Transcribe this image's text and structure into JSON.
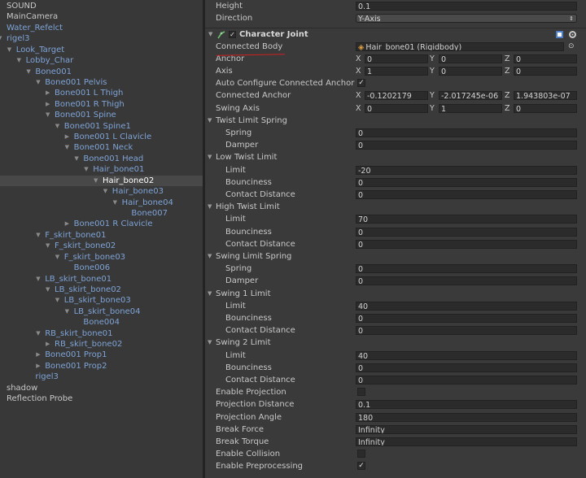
{
  "hierarchy": {
    "items": [
      {
        "label": "SOUND",
        "color": "plain",
        "expanded": null
      },
      {
        "label": "MainCamera",
        "color": "plain",
        "expanded": null
      },
      {
        "label": "Water_Refelct",
        "color": "blue",
        "expanded": null
      },
      {
        "label": "rigel3",
        "color": "blue",
        "expanded": true
      },
      {
        "label": "Look_Target",
        "color": "blue",
        "expanded": true
      },
      {
        "label": "Lobby_Char",
        "color": "blue",
        "expanded": true
      },
      {
        "label": "Bone001",
        "color": "blue",
        "expanded": true
      },
      {
        "label": "Bone001 Pelvis",
        "color": "blue",
        "expanded": true
      },
      {
        "label": "Bone001 L Thigh",
        "color": "blue",
        "expanded": false
      },
      {
        "label": "Bone001 R Thigh",
        "color": "blue",
        "expanded": false
      },
      {
        "label": "Bone001 Spine",
        "color": "blue",
        "expanded": true
      },
      {
        "label": "Bone001 Spine1",
        "color": "blue",
        "expanded": true
      },
      {
        "label": "Bone001 L Clavicle",
        "color": "blue",
        "expanded": false
      },
      {
        "label": "Bone001 Neck",
        "color": "blue",
        "expanded": true
      },
      {
        "label": "Bone001 Head",
        "color": "blue",
        "expanded": true
      },
      {
        "label": "Hair_bone01",
        "color": "blue",
        "expanded": true
      },
      {
        "label": "Hair_bone02",
        "color": "blue",
        "expanded": true,
        "selected": true
      },
      {
        "label": "Hair_bone03",
        "color": "blue",
        "expanded": true
      },
      {
        "label": "Hair_bone04",
        "color": "blue",
        "expanded": true
      },
      {
        "label": "Bone007",
        "color": "blue",
        "expanded": null
      },
      {
        "label": "Bone001 R Clavicle",
        "color": "blue",
        "expanded": false
      },
      {
        "label": "F_skirt_bone01",
        "color": "blue",
        "expanded": true
      },
      {
        "label": "F_skirt_bone02",
        "color": "blue",
        "expanded": true
      },
      {
        "label": "F_skirt_bone03",
        "color": "blue",
        "expanded": true
      },
      {
        "label": "Bone006",
        "color": "blue",
        "expanded": null
      },
      {
        "label": "LB_skirt_bone01",
        "color": "blue",
        "expanded": true
      },
      {
        "label": "LB_skirt_bone02",
        "color": "blue",
        "expanded": true
      },
      {
        "label": "LB_skirt_bone03",
        "color": "blue",
        "expanded": true
      },
      {
        "label": "LB_skirt_bone04",
        "color": "blue",
        "expanded": true
      },
      {
        "label": "Bone004",
        "color": "blue",
        "expanded": null
      },
      {
        "label": "RB_skirt_bone01",
        "color": "blue",
        "expanded": true
      },
      {
        "label": "RB_skirt_bone02",
        "color": "blue",
        "expanded": false
      },
      {
        "label": "Bone001 Prop1",
        "color": "blue",
        "expanded": false
      },
      {
        "label": "Bone001 Prop2",
        "color": "blue",
        "expanded": false
      },
      {
        "label": "rigel3",
        "color": "blue",
        "expanded": null
      },
      {
        "label": "shadow",
        "color": "plain",
        "expanded": null
      },
      {
        "label": "Reflection Probe",
        "color": "plain",
        "expanded": null
      }
    ]
  },
  "inspector": {
    "top_rows": [
      {
        "label": "Height",
        "value": "0.1"
      },
      {
        "label": "Direction",
        "value": "Y-Axis",
        "dropdown": true
      }
    ],
    "component": {
      "title": "Character Joint",
      "icon": "hinge-joint-icon",
      "rows": [
        {
          "kind": "object",
          "label": "Connected Body",
          "value": "Hair_bone01 (Rigidbody)"
        },
        {
          "kind": "vec3",
          "label": "Anchor",
          "x": "0",
          "y": "0",
          "z": "0"
        },
        {
          "kind": "vec3",
          "label": "Axis",
          "x": "1",
          "y": "0",
          "z": "0"
        },
        {
          "kind": "check",
          "label": "Auto Configure Connected Anchor",
          "checked": true
        },
        {
          "kind": "vec3",
          "label": "Connected Anchor",
          "x": "-0.1202179",
          "y": "-2.017245e-06",
          "z": "1.943803e-07"
        },
        {
          "kind": "vec3",
          "label": "Swing Axis",
          "x": "0",
          "y": "1",
          "z": "0"
        },
        {
          "kind": "section",
          "label": "Twist Limit Spring"
        },
        {
          "kind": "field",
          "label": "Spring",
          "value": "0",
          "indent": true
        },
        {
          "kind": "field",
          "label": "Damper",
          "value": "0",
          "indent": true
        },
        {
          "kind": "section",
          "label": "Low Twist Limit"
        },
        {
          "kind": "field",
          "label": "Limit",
          "value": "-20",
          "indent": true
        },
        {
          "kind": "field",
          "label": "Bounciness",
          "value": "0",
          "indent": true
        },
        {
          "kind": "field",
          "label": "Contact Distance",
          "value": "0",
          "indent": true
        },
        {
          "kind": "section",
          "label": "High Twist Limit"
        },
        {
          "kind": "field",
          "label": "Limit",
          "value": "70",
          "indent": true
        },
        {
          "kind": "field",
          "label": "Bounciness",
          "value": "0",
          "indent": true
        },
        {
          "kind": "field",
          "label": "Contact Distance",
          "value": "0",
          "indent": true
        },
        {
          "kind": "section",
          "label": "Swing Limit Spring"
        },
        {
          "kind": "field",
          "label": "Spring",
          "value": "0",
          "indent": true
        },
        {
          "kind": "field",
          "label": "Damper",
          "value": "0",
          "indent": true
        },
        {
          "kind": "section",
          "label": "Swing 1 Limit"
        },
        {
          "kind": "field",
          "label": "Limit",
          "value": "40",
          "indent": true
        },
        {
          "kind": "field",
          "label": "Bounciness",
          "value": "0",
          "indent": true
        },
        {
          "kind": "field",
          "label": "Contact Distance",
          "value": "0",
          "indent": true
        },
        {
          "kind": "section",
          "label": "Swing 2 Limit"
        },
        {
          "kind": "field",
          "label": "Limit",
          "value": "40",
          "indent": true
        },
        {
          "kind": "field",
          "label": "Bounciness",
          "value": "0",
          "indent": true
        },
        {
          "kind": "field",
          "label": "Contact Distance",
          "value": "0",
          "indent": true
        },
        {
          "kind": "check",
          "label": "Enable Projection",
          "checked": false
        },
        {
          "kind": "field",
          "label": "Projection Distance",
          "value": "0.1"
        },
        {
          "kind": "field",
          "label": "Projection Angle",
          "value": "180"
        },
        {
          "kind": "field",
          "label": "Break Force",
          "value": "Infinity"
        },
        {
          "kind": "field",
          "label": "Break Torque",
          "value": "Infinity"
        },
        {
          "kind": "check",
          "label": "Enable Collision",
          "checked": false
        },
        {
          "kind": "check",
          "label": "Enable Preprocessing",
          "checked": true
        }
      ]
    },
    "axis_labels": {
      "x": "X",
      "y": "Y",
      "z": "Z"
    }
  },
  "colors": {
    "accent_blue": "#7ea3d6",
    "annotation_red": "#d02020",
    "panel_bg": "#383838"
  }
}
